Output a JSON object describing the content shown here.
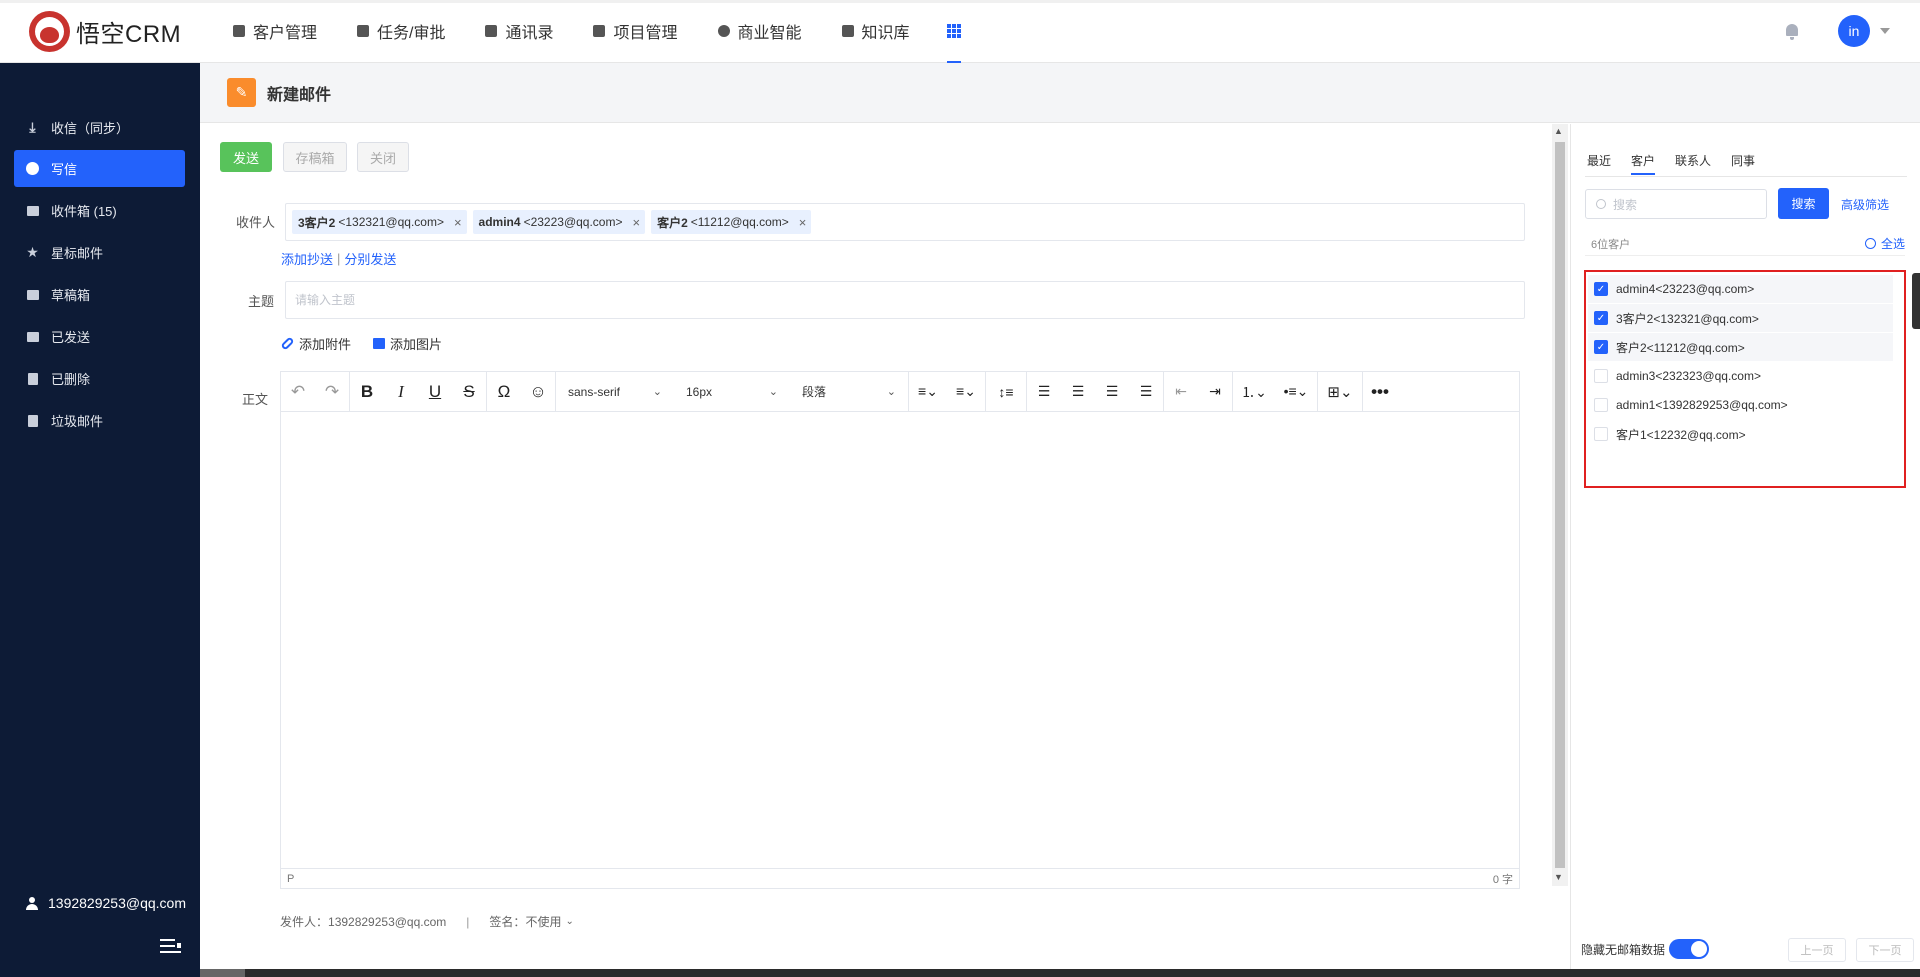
{
  "app": {
    "logo_text": "悟空CRM",
    "accent": "#2362fb",
    "sidebar_bg": "#0d1b36"
  },
  "topnav": {
    "items": [
      {
        "label": "客户管理",
        "icon": "building-icon"
      },
      {
        "label": "任务/审批",
        "icon": "briefcase-icon"
      },
      {
        "label": "通讯录",
        "icon": "contacts-icon"
      },
      {
        "label": "项目管理",
        "icon": "project-icon"
      },
      {
        "label": "商业智能",
        "icon": "bi-icon"
      },
      {
        "label": "知识库",
        "icon": "book-icon"
      }
    ],
    "avatar_text": "in"
  },
  "sidebar": {
    "items": [
      {
        "label": "收信（同步）",
        "icon": "download-icon"
      },
      {
        "label": "写信",
        "icon": "compose-icon",
        "active": true
      },
      {
        "label": "收件箱 (15)",
        "icon": "inbox-icon"
      },
      {
        "label": "星标邮件",
        "icon": "star-icon"
      },
      {
        "label": "草稿箱",
        "icon": "draft-icon"
      },
      {
        "label": "已发送",
        "icon": "sent-icon"
      },
      {
        "label": "已删除",
        "icon": "trash-icon"
      },
      {
        "label": "垃圾邮件",
        "icon": "spam-icon"
      }
    ],
    "user_email": "1392829253@qq.com"
  },
  "header": {
    "title": "新建邮件"
  },
  "compose": {
    "send_label": "发送",
    "draft_label": "存稿箱",
    "close_label": "关闭",
    "to_label": "收件人",
    "recipients": [
      {
        "name": "3客户2",
        "email": "<132321@qq.com>"
      },
      {
        "name": "admin4",
        "email": "<23223@qq.com>"
      },
      {
        "name": "客户2",
        "email": "<11212@qq.com>"
      }
    ],
    "add_cc": "添加抄送",
    "separate_send": "分别发送",
    "subject_label": "主题",
    "subject_placeholder": "请输入主题",
    "add_attachment": "添加附件",
    "add_image": "添加图片",
    "body_label": "正文",
    "font_family": "sans-serif",
    "font_size": "16px",
    "block_format": "段落",
    "status_path": "P",
    "word_count": "0 字",
    "sender_label": "发件人：",
    "sender_email": "1392829253@qq.com",
    "signature_label": "签名：",
    "signature_value": "不使用"
  },
  "right_panel": {
    "tabs": [
      "最近",
      "客户",
      "联系人",
      "同事"
    ],
    "active_tab": "客户",
    "search_placeholder": "搜索",
    "search_button": "搜索",
    "advanced_filter": "高级筛选",
    "count_text": "6位客户",
    "select_all": "全选",
    "contacts": [
      {
        "label": "admin4<23223@qq.com>",
        "checked": true
      },
      {
        "label": "3客户2<132321@qq.com>",
        "checked": true
      },
      {
        "label": "客户2<11212@qq.com>",
        "checked": true
      },
      {
        "label": "admin3<232323@qq.com>",
        "checked": false
      },
      {
        "label": "admin1<1392829253@qq.com>",
        "checked": false
      },
      {
        "label": "客户1<12232@qq.com>",
        "checked": false
      }
    ],
    "hide_no_email": "隐藏无邮箱数据",
    "prev_page": "上一页",
    "next_page": "下一页"
  }
}
